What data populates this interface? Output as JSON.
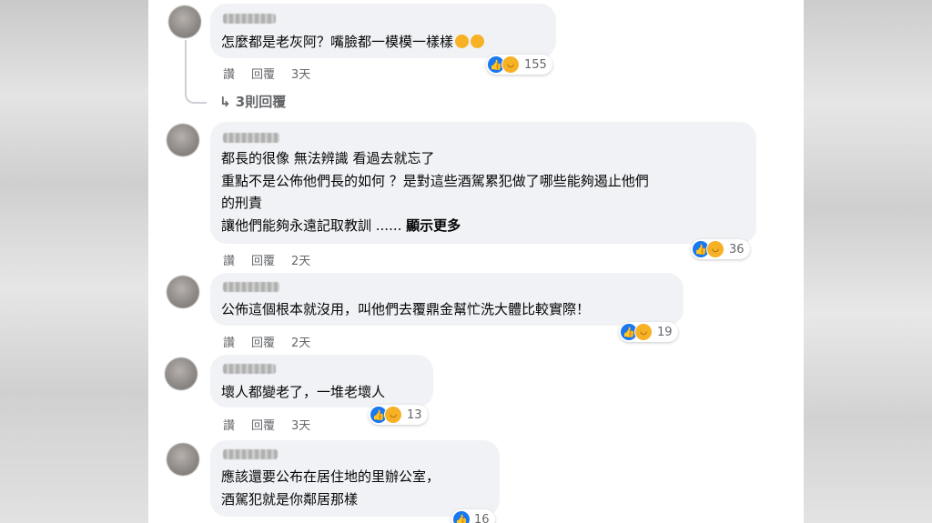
{
  "comments": [
    {
      "text_lines": [
        "怎麼都是老灰阿？嘴臉都一模模一樣樣"
      ],
      "actions": {
        "like": "讚",
        "reply": "回覆",
        "time": "3天"
      },
      "reactions": {
        "count": "155"
      },
      "replies_label": "3則回覆"
    },
    {
      "text_lines": [
        "都長的很像 無法辨識 看過去就忘了",
        "重點不是公佈他們長的如何 ？是對這些酒駕累犯做了哪些能夠遏止他們",
        "的刑責",
        "讓他們能夠永遠記取教訓 ......"
      ],
      "see_more": "顯示更多",
      "actions": {
        "like": "讚",
        "reply": "回覆",
        "time": "2天"
      },
      "reactions": {
        "count": "36"
      }
    },
    {
      "text_lines": [
        "公佈這個根本就沒用，叫他們去覆鼎金幫忙洗大體比較實際！"
      ],
      "actions": {
        "like": "讚",
        "reply": "回覆",
        "time": "2天"
      },
      "reactions": {
        "count": "19"
      }
    },
    {
      "text_lines": [
        "壞人都變老了，一堆老壞人"
      ],
      "actions": {
        "like": "讚",
        "reply": "回覆",
        "time": "3天"
      },
      "reactions": {
        "count": "13"
      }
    },
    {
      "text_lines": [
        "應該還要公布在居住地的里辦公室，",
        "酒駕犯就是你鄰居那樣"
      ],
      "reactions": {
        "count": "16"
      }
    }
  ],
  "icons": {
    "like": "thumbs-up-icon",
    "haha": "laughing-face-icon",
    "reply_arrow": "reply-arrow-icon"
  },
  "colors": {
    "like_blue": "#1877f2",
    "bubble": "#f0f2f5",
    "meta_gray": "#65676b"
  }
}
